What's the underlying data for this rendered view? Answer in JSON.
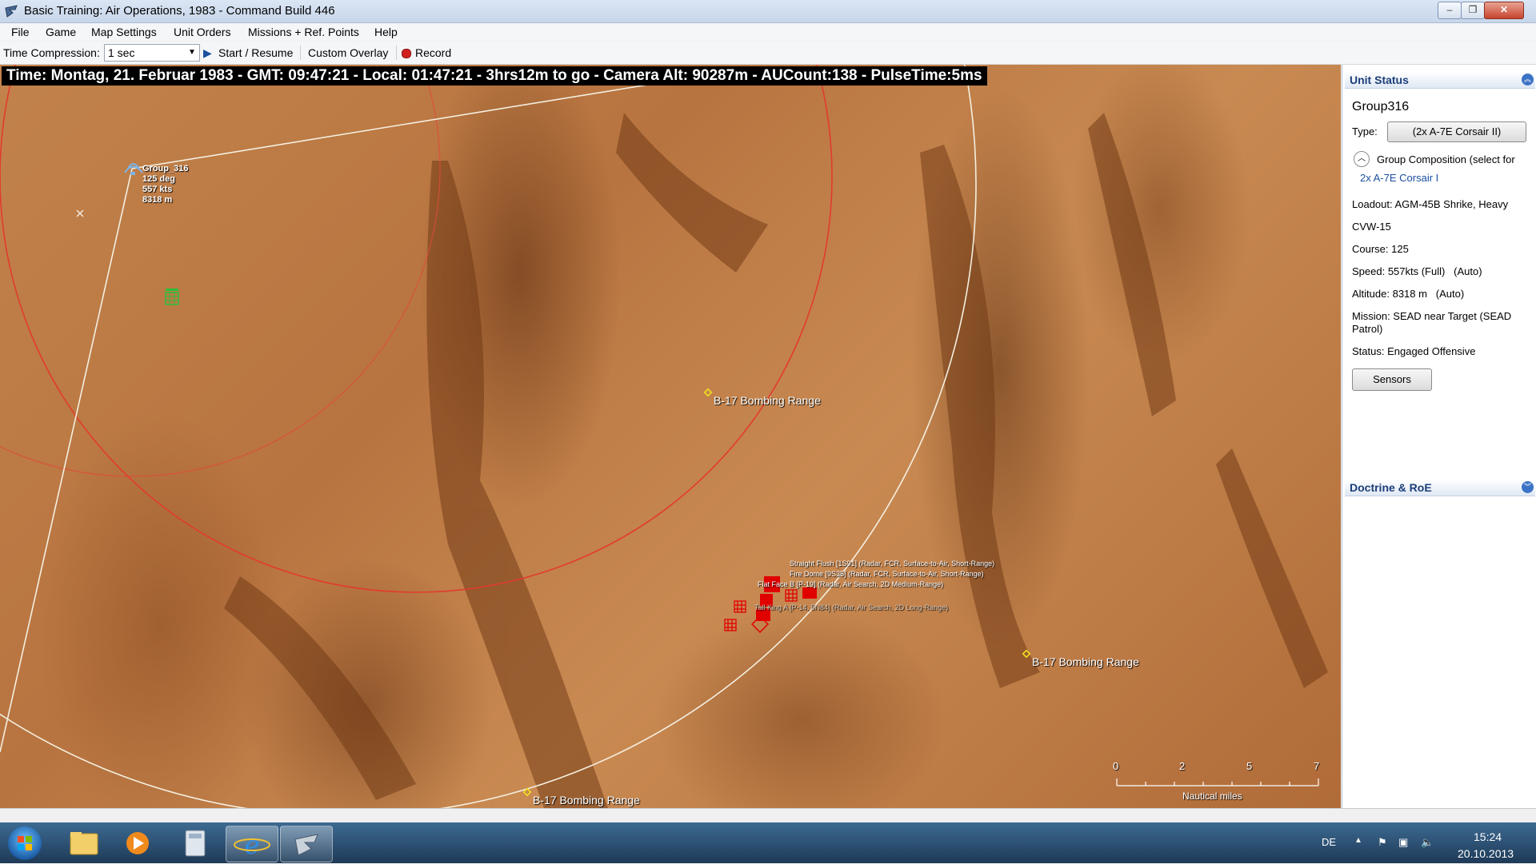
{
  "window": {
    "title": "Basic Training: Air Operations, 1983 - Command Build 446",
    "minimize": "–",
    "maximize": "❐",
    "close": "✕"
  },
  "menu": [
    "File",
    "Game",
    "Map Settings",
    "Unit Orders",
    "Missions + Ref. Points",
    "Help"
  ],
  "toolbar": {
    "time_compression_label": "Time Compression:",
    "time_compression_value": "1 sec",
    "start_resume": "Start / Resume",
    "custom_overlay": "Custom Overlay",
    "record": "Record"
  },
  "map": {
    "time_banner": "Time: Montag, 21. Februar 1983 - GMT: 09:47:21 - Local: 01:47:21 - 3hrs12m to go -  Camera Alt: 90287m - AUCount:138 - PulseTime:5ms",
    "unit": {
      "name": "Group_316",
      "heading": "125 deg",
      "speed": "557 kts",
      "altitude": "8318 m"
    },
    "reference_points": [
      "B-17 Bombing Range",
      "B-17 Bombing Range",
      "B-17 Bombing Range"
    ],
    "contacts": [
      "Straight Flush [1S91] (Radar, FCR, Surface-to-Air, Short-Range)",
      "Fire Dome [9S35] (Radar, FCR, Surface-to-Air, Short-Range)",
      "Flat Face B [P-19] (Radar, Air Search, 2D Medium-Range)",
      "Tall King A [P-14, 5N84] (Radar, Air Search, 2D Long-Range)"
    ],
    "scale": {
      "ticks": [
        "0",
        "2",
        "5",
        "7"
      ],
      "unit_label": "Nautical miles"
    }
  },
  "unit_status": {
    "header": "Unit Status",
    "name": "Group316",
    "type_label": "Type:",
    "type_value": "(2x A-7E Corsair II)",
    "composition_label": "Group Composition (select for",
    "composition_item": "2x A-7E Corsair I",
    "loadout": "Loadout: AGM-45B Shrike, Heavy",
    "wing": "CVW-15",
    "course": "Course: 125",
    "speed": "Speed: 557kts (Full)   (Auto)",
    "altitude": "Altitude: 8318 m   (Auto)",
    "mission_line1": "Mission: SEAD near Target (SEAD",
    "mission_line2": "Patrol)",
    "status": "Status: Engaged Offensive",
    "sensors_button": "Sensors"
  },
  "doctrine": {
    "header": "Doctrine & RoE"
  },
  "taskbar": {
    "language": "DE",
    "time": "15:24",
    "date": "20.10.2013"
  },
  "colors": {
    "terrain": "#b87440",
    "range_ring_red": "#e23b2e",
    "range_ring_white": "#f4efe0",
    "contact_red": "#e00000",
    "refpoint_yellow": "#f0e020",
    "panel_header_text": "#1c3f7a"
  }
}
